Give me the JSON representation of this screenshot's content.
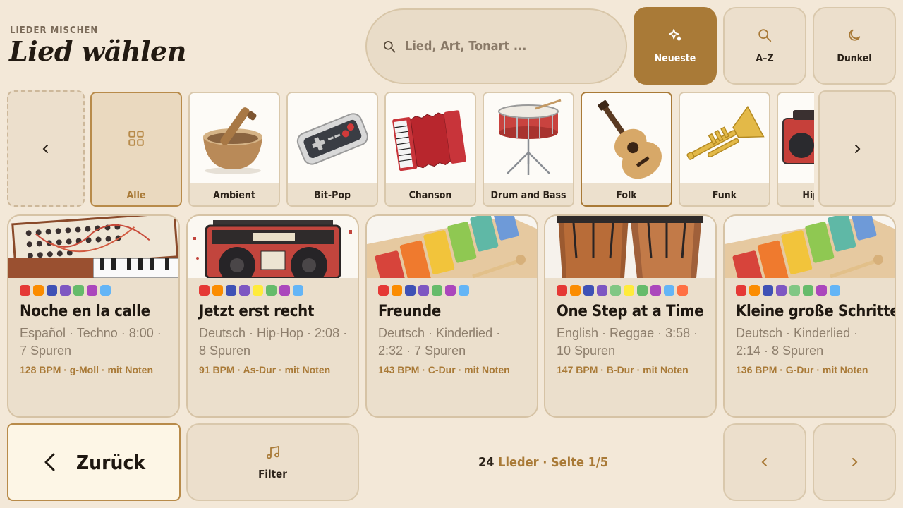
{
  "header": {
    "kicker": "LIEDER MISCHEN",
    "title": "Lied wählen"
  },
  "search": {
    "placeholder": "Lied, Art, Tonart ..."
  },
  "sort_buttons": [
    {
      "label": "Neueste",
      "icon": "sparkle-icon",
      "active": true
    },
    {
      "label": "A–Z",
      "icon": "search-icon",
      "active": false
    },
    {
      "label": "Dunkel",
      "icon": "moon-icon",
      "active": false
    }
  ],
  "genres": [
    {
      "label": "Alle",
      "icon": "grid-icon"
    },
    {
      "label": "Ambient",
      "icon": "singing-bowl-icon"
    },
    {
      "label": "Bit-Pop",
      "icon": "gamepad-icon"
    },
    {
      "label": "Chanson",
      "icon": "accordion-icon"
    },
    {
      "label": "Drum and Bass",
      "icon": "snare-drum-icon"
    },
    {
      "label": "Folk",
      "icon": "guitar-icon"
    },
    {
      "label": "Funk",
      "icon": "trumpet-icon"
    },
    {
      "label": "Hip-Hop",
      "icon": "boombox-icon"
    }
  ],
  "selected_genre": "Folk",
  "songs": [
    {
      "title": "Noche en la calle",
      "meta": "Español · Techno · 8:00 · 7 Spuren",
      "tech": "128 BPM · g-Moll · mit Noten",
      "image": "synthesizer",
      "colors": [
        "#e53935",
        "#fb8c00",
        "#3f51b5",
        "#7e57c2",
        "#66bb6a",
        "#ab47bc",
        "#64b5f6"
      ]
    },
    {
      "title": "Jetzt erst recht",
      "meta": "Deutsch · Hip-Hop · 2:08 · 8 Spuren",
      "tech": "91 BPM · As-Dur · mit Noten",
      "image": "boombox",
      "colors": [
        "#e53935",
        "#fb8c00",
        "#3f51b5",
        "#7e57c2",
        "#ffeb3b",
        "#66bb6a",
        "#ab47bc",
        "#64b5f6"
      ]
    },
    {
      "title": "Freunde",
      "meta": "Deutsch · Kinderlied · 2:32 · 7 Spuren",
      "tech": "143 BPM · C-Dur · mit Noten",
      "image": "xylophone",
      "colors": [
        "#e53935",
        "#fb8c00",
        "#3f51b5",
        "#7e57c2",
        "#66bb6a",
        "#ab47bc",
        "#64b5f6"
      ]
    },
    {
      "title": "One Step at a Time",
      "meta": "English · Reggae · 3:58 · 10 Spuren",
      "tech": "147 BPM · B-Dur · mit Noten",
      "image": "congas",
      "colors": [
        "#e53935",
        "#fb8c00",
        "#3f51b5",
        "#7e57c2",
        "#81c784",
        "#ffeb3b",
        "#66bb6a",
        "#ab47bc",
        "#64b5f6",
        "#ff7043"
      ]
    },
    {
      "title": "Kleine große Schritte",
      "meta": "Deutsch · Kinderlied · 2:14 · 8 Spuren",
      "tech": "136 BPM · G-Dur · mit Noten",
      "image": "xylophone",
      "colors": [
        "#e53935",
        "#fb8c00",
        "#3f51b5",
        "#7e57c2",
        "#81c784",
        "#66bb6a",
        "#ab47bc",
        "#64b5f6"
      ]
    }
  ],
  "footer": {
    "back_label": "Zurück",
    "filter_label": "Filter",
    "count": "24",
    "count_suffix": " Lieder · Seite 1/5"
  },
  "colors": {
    "accent": "#a97a37",
    "background": "#f3e8d8"
  }
}
